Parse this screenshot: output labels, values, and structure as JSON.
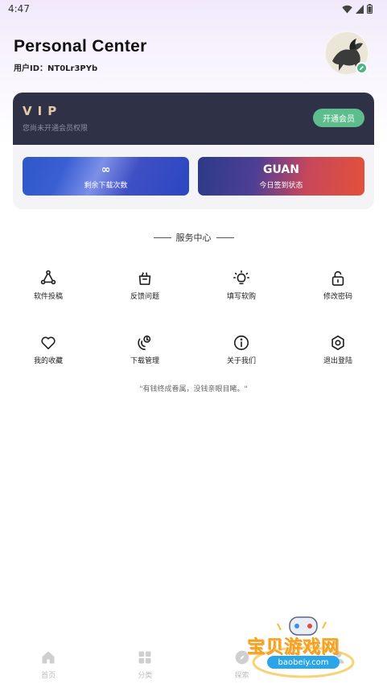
{
  "status_bar": {
    "time": "4:47"
  },
  "header": {
    "title": "Personal Center",
    "user_id": "用户ID：NT0Lr3PYb"
  },
  "vip": {
    "title": "VIP",
    "subtitle": "您尚未开通会员权限",
    "button": "开通会员"
  },
  "stats": [
    {
      "value": "∞",
      "label": "剩余下载次数"
    },
    {
      "value": "GUAN",
      "label": "今日签到状态"
    }
  ],
  "services": {
    "title": "服务中心",
    "items": [
      {
        "label": "软件投稿",
        "icon": "triangle-nodes-icon"
      },
      {
        "label": "反馈问题",
        "icon": "feedback-icon"
      },
      {
        "label": "填写软购",
        "icon": "lightbulb-icon"
      },
      {
        "label": "修改密码",
        "icon": "lock-icon"
      },
      {
        "label": "我的收藏",
        "icon": "heart-icon"
      },
      {
        "label": "下载管理",
        "icon": "download-manage-icon"
      },
      {
        "label": "关于我们",
        "icon": "info-icon"
      },
      {
        "label": "退出登陆",
        "icon": "logout-hexagon-icon"
      }
    ]
  },
  "quote": "\"有钱终成眷属，没钱亲眼目睹。\"",
  "tabs": [
    {
      "label": "首页",
      "icon": "home-icon"
    },
    {
      "label": "分类",
      "icon": "grid-icon"
    },
    {
      "label": "探索",
      "icon": "compass-icon"
    },
    {
      "label": "",
      "icon": "user-icon"
    }
  ],
  "watermark": {
    "text": "宝贝游戏网",
    "url": "baobeiy.com"
  },
  "colors": {
    "vip_bg": "#2f3246",
    "vip_button": "#5dbd8c",
    "accent_gold": "#e6c8a8"
  }
}
